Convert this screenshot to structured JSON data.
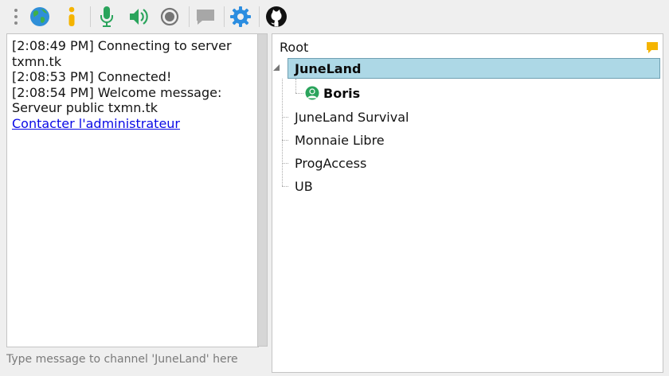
{
  "toolbar": {
    "icons": [
      "grip-icon",
      "globe-icon",
      "info-icon",
      "microphone-icon",
      "speaker-icon",
      "record-icon",
      "chat-icon",
      "settings-icon",
      "github-icon"
    ],
    "colors": {
      "microphone": "#2aa45c",
      "speaker": "#2aa45c",
      "settings": "#2b8de0",
      "info": "#f5b400"
    }
  },
  "chat": {
    "lines": [
      "[2:08:49 PM] Connecting to server txmn.tk",
      "[2:08:53 PM] Connected!",
      "[2:08:54 PM] Welcome message: Serveur public txmn.tk"
    ],
    "link": "Contacter l'administrateur"
  },
  "message_input": {
    "placeholder": "Type message to channel 'JuneLand' here",
    "value": ""
  },
  "tree": {
    "root": "Root",
    "selected_channel": "JuneLand",
    "users": [
      "Boris"
    ],
    "channels": [
      "JuneLand Survival",
      "Monnaie Libre",
      "ProgAccess",
      "UB"
    ],
    "selection_color": "#add8e6",
    "comment_icon_color": "#f5b400"
  }
}
